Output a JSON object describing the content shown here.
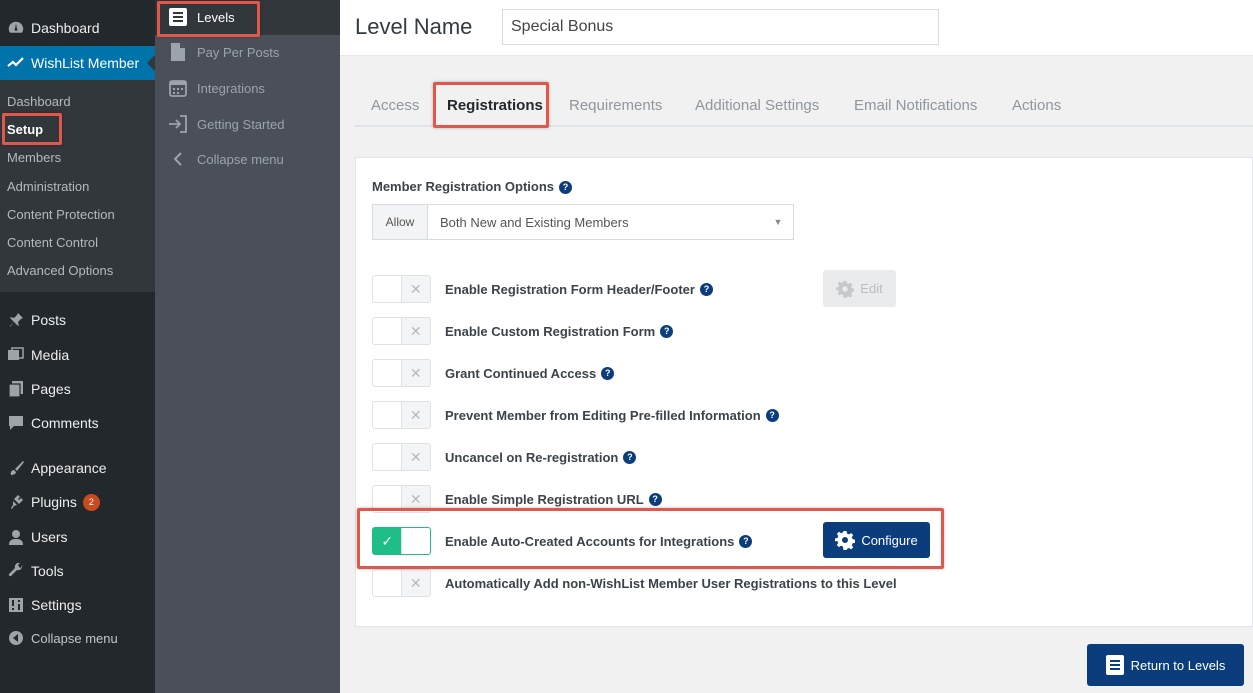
{
  "wp_menu": {
    "dashboard": "Dashboard",
    "wishlist": "WishList Member",
    "submenu": [
      "Dashboard",
      "Setup",
      "Members",
      "Administration",
      "Content Protection",
      "Content Control",
      "Advanced Options"
    ],
    "posts": "Posts",
    "media": "Media",
    "pages": "Pages",
    "comments": "Comments",
    "appearance": "Appearance",
    "plugins": "Plugins",
    "plugins_badge": "2",
    "users": "Users",
    "tools": "Tools",
    "settings": "Settings",
    "collapse": "Collapse menu"
  },
  "wl_menu": {
    "levels": "Levels",
    "pay_per_posts": "Pay Per Posts",
    "integrations": "Integrations",
    "getting_started": "Getting Started",
    "collapse": "Collapse menu"
  },
  "header": {
    "title": "Level Name",
    "level_name_value": "Special Bonus"
  },
  "tabs": [
    "Access",
    "Registrations",
    "Requirements",
    "Additional Settings",
    "Email Notifications",
    "Actions"
  ],
  "registration": {
    "options_label": "Member Registration Options",
    "allow_addon": "Allow",
    "allow_value": "Both New and Existing Members",
    "settings": [
      {
        "label": "Enable Registration Form Header/Footer",
        "enabled": false
      },
      {
        "label": "Enable Custom Registration Form",
        "enabled": false
      },
      {
        "label": "Grant Continued Access",
        "enabled": false
      },
      {
        "label": "Prevent Member from Editing Pre-filled Information",
        "enabled": false
      },
      {
        "label": "Uncancel on Re-registration",
        "enabled": false
      },
      {
        "label": "Enable Simple Registration URL",
        "enabled": false
      },
      {
        "label": "Enable Auto-Created Accounts for Integrations",
        "enabled": true
      },
      {
        "label": "Automatically Add non-WishList Member User Registrations to this Level",
        "enabled": false
      }
    ],
    "edit_label": "Edit",
    "configure_label": "Configure"
  },
  "footer": {
    "return_label": "Return to Levels"
  },
  "colors": {
    "accent": "#0b3d7c",
    "toggle_on": "#1fbd88",
    "highlight": "#e2574c",
    "wp_active": "#0073aa"
  }
}
